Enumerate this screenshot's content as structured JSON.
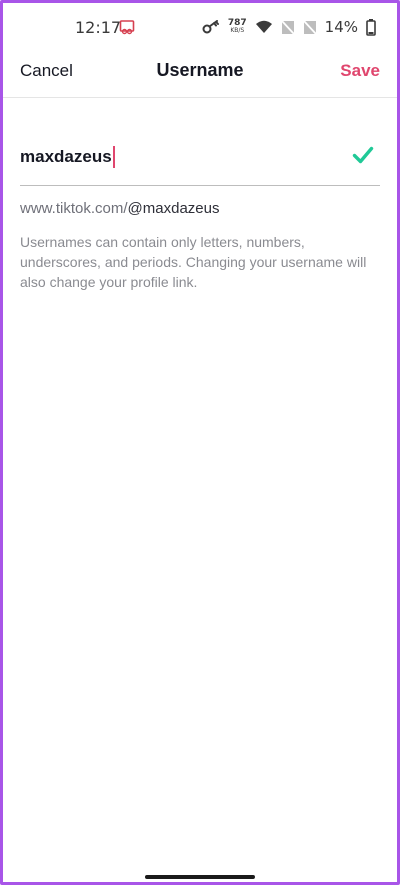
{
  "status_bar": {
    "time": "12:17",
    "net_speed_value": "787",
    "net_speed_unit": "KB/S",
    "battery_percent": "14%",
    "icons": [
      "screen-record-icon",
      "key-icon",
      "wifi-icon",
      "no-sim-icon",
      "no-sim-icon",
      "battery-icon"
    ]
  },
  "navbar": {
    "cancel_label": "Cancel",
    "title": "Username",
    "save_label": "Save"
  },
  "username_field": {
    "value": "maxdazeus",
    "status_icon": "check-icon"
  },
  "profile_link": {
    "prefix": "www.tiktok.com/",
    "handle": "@maxdazeus"
  },
  "hint_text": "Usernames can contain only letters, numbers, underscores, and periods. Changing your username will also change your profile link.",
  "colors": {
    "accent": "#e0466e",
    "check": "#20c997",
    "frame": "#a855e8"
  }
}
